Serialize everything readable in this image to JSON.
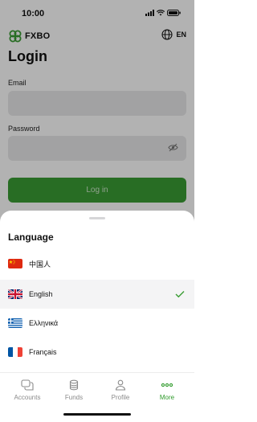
{
  "status_bar": {
    "time": "10:00"
  },
  "header": {
    "brand_name": "FXBO",
    "language_code": "EN"
  },
  "login": {
    "title": "Login",
    "email_label": "Email",
    "email_value": "",
    "password_label": "Password",
    "password_value": "",
    "button_label": "Log in"
  },
  "language_sheet": {
    "title": "Language",
    "options": [
      {
        "label": "中国人",
        "flag": "cn-flag-icon",
        "selected": false
      },
      {
        "label": "English",
        "flag": "uk-flag-icon",
        "selected": true
      },
      {
        "label": "Ελληνικά",
        "flag": "greece-flag-icon",
        "selected": false
      },
      {
        "label": "Français",
        "flag": "france-flag-icon",
        "selected": false
      }
    ]
  },
  "tab_bar": {
    "tabs": [
      {
        "label": "Accounts",
        "icon": "chat-bubbles-icon",
        "active": false
      },
      {
        "label": "Funds",
        "icon": "coins-stack-icon",
        "active": false
      },
      {
        "label": "Profile",
        "icon": "user-icon",
        "active": false
      },
      {
        "label": "More",
        "icon": "more-dots-icon",
        "active": true
      }
    ]
  },
  "colors": {
    "accent": "#3a9d34",
    "active_tab": "#2f9a2b",
    "check": "#3a9d34"
  }
}
